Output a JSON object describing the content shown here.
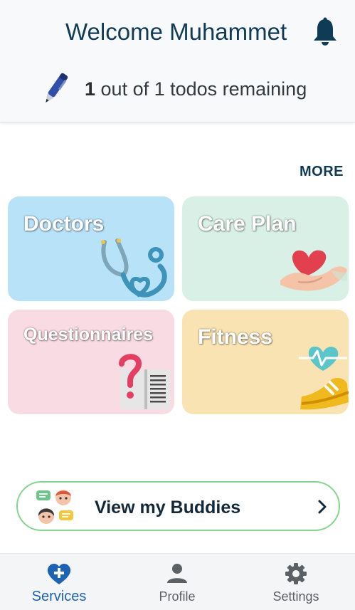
{
  "header": {
    "welcome_text": "Welcome Muhammet",
    "todos_count": "1",
    "todos_text": " out of 1 todos remaining"
  },
  "more_label": "MORE",
  "tiles": [
    {
      "label": "Doctors",
      "color": "#b7e2f8"
    },
    {
      "label": "Care Plan",
      "color": "#d8f0e6"
    },
    {
      "label": "Questionnaires",
      "color": "#f9dbe3"
    },
    {
      "label": "Fitness",
      "color": "#f9e3b2"
    }
  ],
  "buddies": {
    "label": "View my Buddies"
  },
  "bottom_nav": [
    {
      "label": "Services",
      "icon": "heart-plus-icon",
      "active": true
    },
    {
      "label": "Profile",
      "icon": "person-icon",
      "active": false
    },
    {
      "label": "Settings",
      "icon": "gear-icon",
      "active": false
    }
  ],
  "colors": {
    "accent": "#1e63b3",
    "title": "#0f3b57",
    "buddies_border": "#86d58e"
  }
}
